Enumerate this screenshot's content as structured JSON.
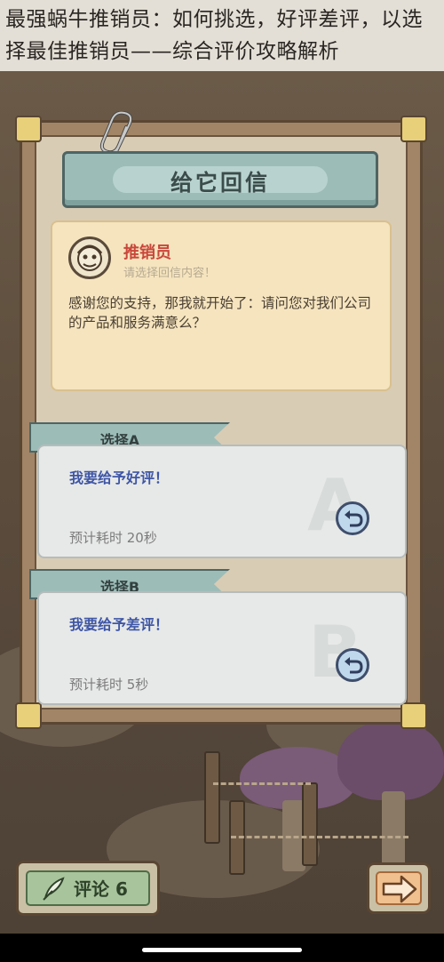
{
  "article": {
    "title": "最强蜗牛推销员：如何挑选，好评差评，以选择最佳推销员——综合评价攻略解析"
  },
  "dialog": {
    "title": "给它回信",
    "speaker": "推销员",
    "prompt": "请选择回信内容！",
    "message": "感谢您的支持，那我就开始了：请问您对我们公司的产品和服务满意么？"
  },
  "options": [
    {
      "tab": "选择A",
      "letter": "A",
      "text": "我要给予好评！",
      "time": "预计耗时  20秒"
    },
    {
      "tab": "选择B",
      "letter": "B",
      "text": "我要给予差评！",
      "time": "预计耗时  5秒"
    }
  ],
  "footer": {
    "comment_label": "评论 6"
  },
  "colors": {
    "accent_teal": "#9cbcb8",
    "speaker_red": "#c9473b",
    "choice_blue": "#3f56a6"
  }
}
